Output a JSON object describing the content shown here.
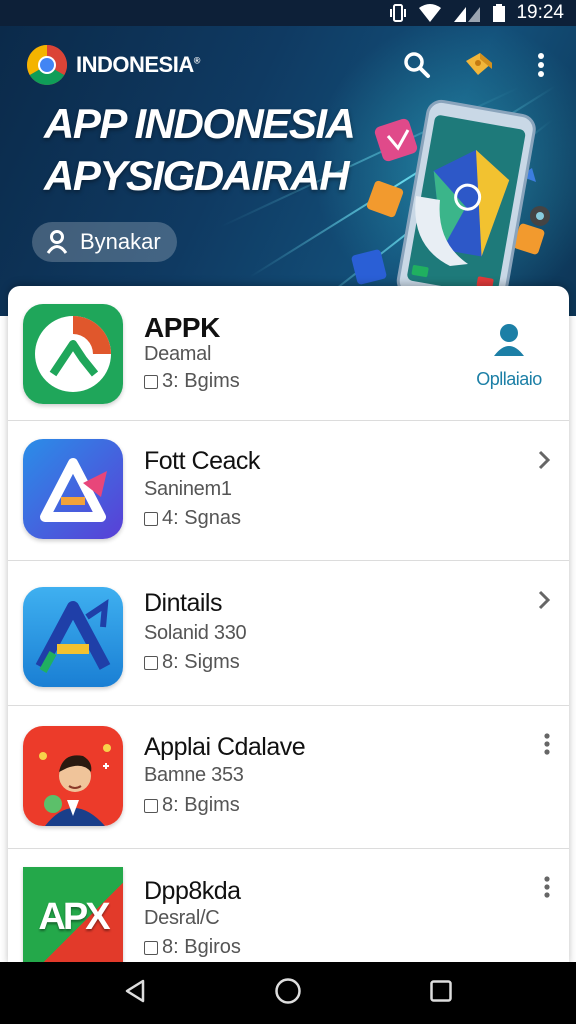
{
  "status_bar": {
    "time": "19:24",
    "icons": [
      "vibrate-icon",
      "wifi-icon",
      "signal-icon",
      "battery-icon"
    ]
  },
  "header": {
    "brand": "INDONESIA",
    "brand_mark": "®",
    "title_line1": "APP INDONESIA",
    "title_line2": "APYSIGDAIRAH",
    "chip_label": "Bynakar",
    "actions": [
      "search-icon",
      "puzzle-icon",
      "more-vert-icon"
    ]
  },
  "apps": [
    {
      "title": "APPK",
      "subtitle": "Deamal",
      "meta": "3: Bgims",
      "action_label": "Opllaiaio",
      "trail": "person-icon"
    },
    {
      "title": "Fott Ceack",
      "subtitle": "Saninem1",
      "meta": "4: Sgnas",
      "trail": "chevron-right-icon"
    },
    {
      "title": "Dintails",
      "subtitle": "Solanid 330",
      "meta": "8: Sigms",
      "trail": "chevron-right-icon"
    },
    {
      "title": "Applai Cdalave",
      "subtitle": "Bamne 353",
      "meta": "8: Bgims",
      "trail": "more-vert-icon"
    },
    {
      "title": "Dpp8kda",
      "subtitle": "Desral/C",
      "meta": "8: Bgiros",
      "icon_text": "APX",
      "trail": "more-vert-icon"
    }
  ],
  "nav": [
    "back-icon",
    "home-icon",
    "recents-icon"
  ],
  "colors": {
    "header_bg": "#0f3a62",
    "accent": "#1c7fa6",
    "divider": "#dcdcdc"
  }
}
